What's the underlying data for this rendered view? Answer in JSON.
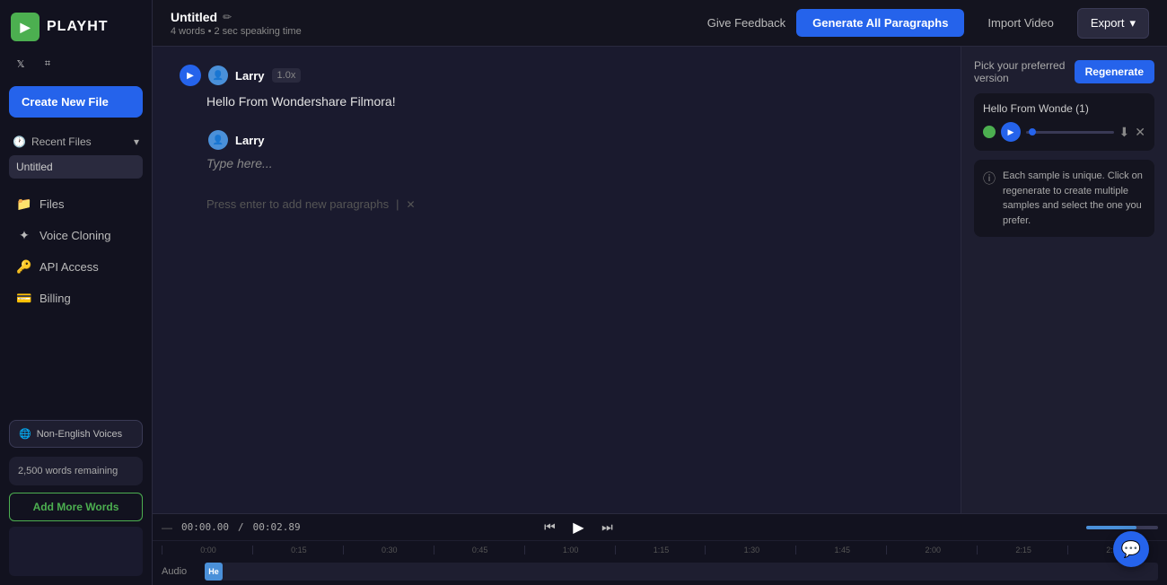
{
  "sidebar": {
    "logo_text": "PLAYHT",
    "logo_initial": "▶",
    "create_new_label": "Create New File",
    "recent_section_label": "Recent Files",
    "recent_files": [
      {
        "name": "Untitled"
      }
    ],
    "nav_items": [
      {
        "label": "Files",
        "icon": "📁",
        "name": "files"
      },
      {
        "label": "Voice Cloning",
        "icon": "✦",
        "name": "voice-cloning"
      },
      {
        "label": "API Access",
        "icon": "🔑",
        "name": "api-access"
      },
      {
        "label": "Billing",
        "icon": "💳",
        "name": "billing"
      }
    ],
    "non_english_label": "Non-English Voices",
    "words_remaining": "2,500 words remaining",
    "add_more_words_label": "Add More Words"
  },
  "topbar": {
    "file_title": "Untitled",
    "file_meta": "4 words • 2 sec speaking time",
    "give_feedback_label": "Give Feedback",
    "generate_btn_label": "Generate All Paragraphs",
    "import_video_label": "Import Video",
    "export_label": "Export"
  },
  "editor": {
    "paragraphs": [
      {
        "speaker": "Larry",
        "speed": "1.0x",
        "text": "Hello From Wondershare Filmora!"
      },
      {
        "speaker": "Larry",
        "speed": "",
        "text": "",
        "placeholder": "Type here..."
      }
    ],
    "add_paragraph_hint": "Press enter to add new paragraphs"
  },
  "version_panel": {
    "title": "Pick your preferred version",
    "regenerate_label": "Regenerate",
    "sample_title": "Hello From Wonde (1)",
    "info_text": "Each sample is unique. Click on regenerate to create multiple samples and select the one you prefer."
  },
  "timeline": {
    "time_current": "00:00.00",
    "time_divider": "/",
    "time_total": "00:02.89",
    "ruler_marks": [
      "0:00",
      "0:15",
      "0:30",
      "0:45",
      "1:00",
      "1:15",
      "1:30",
      "1:45",
      "2:00",
      "2:15",
      "2:30"
    ],
    "track_label": "Audio",
    "audio_block_label": "He"
  },
  "icons": {
    "twitter": "𝕏",
    "discord": "⌗",
    "chevron_down": "▾",
    "edit": "✏",
    "play": "▶",
    "prev": "⏮",
    "next": "⏭",
    "info": "ⓘ",
    "download": "⬇",
    "close": "✕",
    "chat": "💬"
  },
  "colors": {
    "accent_blue": "#2563eb",
    "accent_green": "#4CAF50",
    "sidebar_bg": "#12121f",
    "main_bg": "#1a1a2e",
    "panel_bg": "#1e1e30",
    "speaker_color": "#4a90d9"
  }
}
